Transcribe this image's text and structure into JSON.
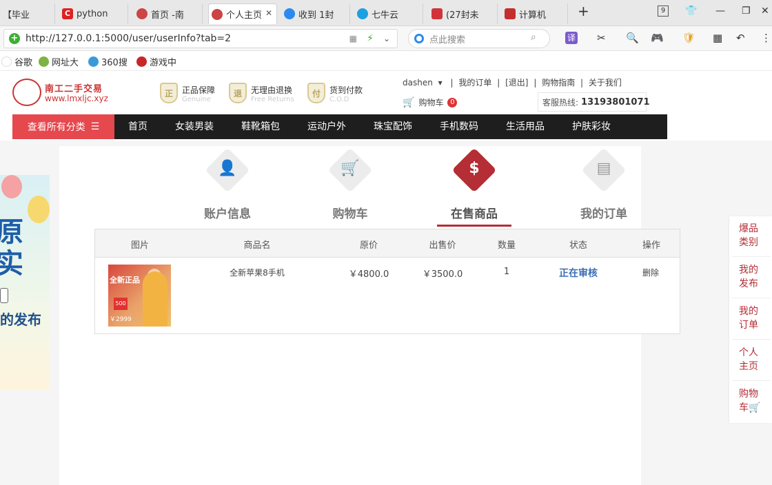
{
  "browser": {
    "tabs": [
      {
        "label": "【毕业",
        "fav_color": "#c33",
        "fav_text": ""
      },
      {
        "label": "python",
        "fav_color": "#d22",
        "fav_text": "C"
      },
      {
        "label": "首页 -南",
        "fav_color": "#c44",
        "fav_text": ""
      },
      {
        "label": "个人主页",
        "fav_color": "#c44",
        "fav_text": "",
        "active": true
      },
      {
        "label": "收到 1封",
        "fav_color": "#2b8af0",
        "fav_text": ""
      },
      {
        "label": "七牛云",
        "fav_color": "#1ba0e1",
        "fav_text": ""
      },
      {
        "label": "(27封未",
        "fav_color": "#d0343a",
        "fav_text": ""
      },
      {
        "label": "计算机",
        "fav_color": "#c42e2e",
        "fav_text": ""
      }
    ],
    "new_tab": "+",
    "tab_count": "9",
    "url": "http://127.0.0.1:5000/user/userInfo?tab=2",
    "search_placeholder": "点此搜索",
    "translate_label": "译",
    "bookmarks": [
      {
        "label": "谷歌",
        "icon_color": "#ffffff"
      },
      {
        "label": "网址大",
        "icon_color": "#7cb342"
      },
      {
        "label": "360搜",
        "icon_color": "#3a9ad9"
      },
      {
        "label": "游戏中",
        "icon_color": "#c62828"
      }
    ]
  },
  "site": {
    "logo_title": "南工二手交易",
    "logo_url": "www.lmxljc.xyz",
    "features": [
      {
        "title": "正品保障",
        "sub": "Genuine",
        "badge": "正"
      },
      {
        "title": "无理由退换",
        "sub": "Free Returns",
        "badge": "退"
      },
      {
        "title": "货到付款",
        "sub": "C.O.D",
        "badge": "付"
      }
    ],
    "user_name": "dashen",
    "links": [
      "我的订单",
      "[退出]",
      "购物指南",
      "关于我们"
    ],
    "cart_label": "购物车",
    "cart_count": "0",
    "hotline_label": "客服热线:",
    "hotline_number": "13193801071",
    "nav_all": "查看所有分类",
    "nav_items": [
      "首页",
      "女装男装",
      "鞋靴箱包",
      "运动户外",
      "珠宝配饰",
      "手机数码",
      "生活用品",
      "护肤彩妆"
    ]
  },
  "banner": {
    "big_text": "原\n实",
    "sub_text": "的发布"
  },
  "steps": [
    {
      "label": "账户信息",
      "icon": "user-icon",
      "symbol": "👤"
    },
    {
      "label": "购物车",
      "icon": "cart-icon",
      "symbol": "🛒"
    },
    {
      "label": "在售商品",
      "icon": "dollar-icon",
      "symbol": "$",
      "current": true
    },
    {
      "label": "我的订单",
      "icon": "list-icon",
      "symbol": "▤"
    }
  ],
  "table": {
    "headers": [
      "图片",
      "商品名",
      "原价",
      "出售价",
      "数量",
      "状态",
      "操作"
    ],
    "rows": [
      {
        "name": "全新苹果8手机",
        "original_price": "￥4800.0",
        "sale_price": "￥3500.0",
        "quantity": "1",
        "status": "正在审核",
        "action": "删除",
        "image_text": "全新正品",
        "image_tag": "500",
        "image_price": "￥2999"
      }
    ]
  },
  "right_bar": [
    "爆品类别",
    "我的发布",
    "我的订单",
    "个人主页",
    "购物车"
  ],
  "colors": {
    "accent": "#b52d35",
    "nav_bg": "#1e1e1e",
    "nav_all_bg": "#e5484d",
    "status_blue": "#3b6db4"
  }
}
